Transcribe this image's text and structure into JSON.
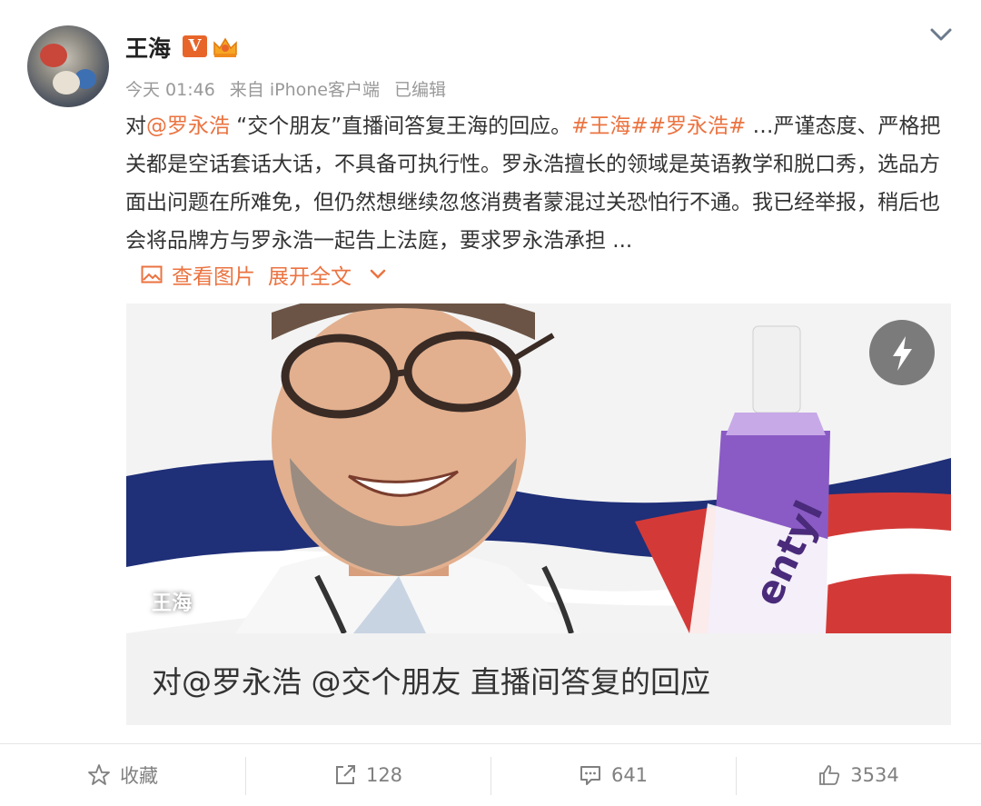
{
  "post": {
    "author": "王海",
    "meta": {
      "time": "今天 01:46",
      "source": "来自 iPhone客户端",
      "edited": "已编辑"
    },
    "text": {
      "prefix": "对",
      "mention": "@罗永浩",
      "part1": " “交个朋友”直播间答复王海的回应。",
      "hashtag1": "#王海#",
      "hashtag2": "#罗永浩#",
      "part2": " …严谨态度、严格把关都是空话套话大话，不具备可执行性。罗永浩擅长的领域是英语教学和脱口秀，选品方面出问题在所难免，但仍然想继续忽悠消费者蒙混过关恐怕行不通。我已经举报，稍后也会将品牌方与罗永浩一起告上法庭，要求罗永浩承担 ..."
    },
    "view_images": "查看图片",
    "expand": "展开全文"
  },
  "card": {
    "author_overlay": "王海",
    "title": "对@罗永浩 @交个朋友 直播间答复的回应",
    "product_text": "entyl"
  },
  "actions": {
    "favorite": "收藏",
    "repost_count": "128",
    "comment_count": "641",
    "like_count": "3534"
  },
  "colors": {
    "accent": "#eb7340",
    "vip": "#e8652a",
    "muted": "#999999"
  },
  "icons": {
    "verified": "v-badge-icon",
    "member": "crown-icon",
    "more": "chevron-down-icon",
    "image": "image-icon",
    "flash": "flash-icon",
    "favorite": "star-icon",
    "repost": "repost-icon",
    "comment": "comment-icon",
    "like": "thumbs-up-icon"
  }
}
